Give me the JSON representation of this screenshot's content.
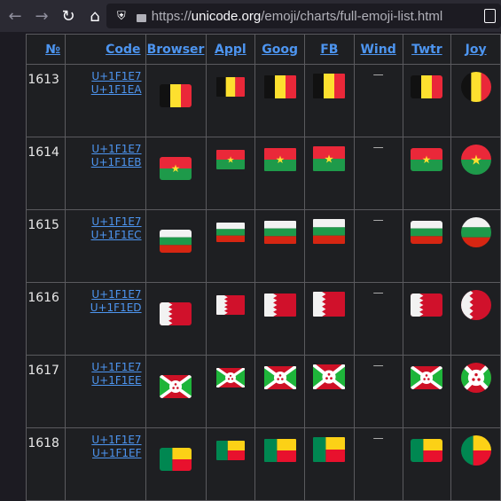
{
  "browser": {
    "back_icon": "arrow-left-icon",
    "forward_icon": "arrow-right-icon",
    "reload_icon": "reload-icon",
    "home_icon": "home-icon",
    "shield_icon": "tracking-protection-icon",
    "lock_icon": "lock-icon",
    "reader_icon": "reader-view-icon",
    "url_scheme": "https://",
    "url_host": "unicode.org",
    "url_path": "/emoji/charts/full-emoji-list.html"
  },
  "table": {
    "headers": [
      "№",
      "Code",
      "Browser",
      "Appl",
      "Goog",
      "FB",
      "Wind",
      "Twtr",
      "Joy"
    ],
    "missing_marker": "—",
    "rows": [
      {
        "num": "1613",
        "code1": "U+1F1E7",
        "code2": "U+1F1EA",
        "flag": "belgium",
        "colors": [
          "#1a1a1a",
          "#fde02f",
          "#ea2839"
        ]
      },
      {
        "num": "1614",
        "code1": "U+1F1E7",
        "code2": "U+1F1EB",
        "flag": "burkina-faso",
        "colors": [
          "#ea2839",
          "#1e9a4a",
          "#fde02f"
        ]
      },
      {
        "num": "1615",
        "code1": "U+1F1E7",
        "code2": "U+1F1EC",
        "flag": "bulgaria",
        "colors": [
          "#f2f2f2",
          "#1e9a4a",
          "#d62612"
        ]
      },
      {
        "num": "1616",
        "code1": "U+1F1E7",
        "code2": "U+1F1ED",
        "flag": "bahrain",
        "colors": [
          "#f2f2f2",
          "#d0112b"
        ]
      },
      {
        "num": "1617",
        "code1": "U+1F1E7",
        "code2": "U+1F1EE",
        "flag": "burundi",
        "colors": [
          "#ce1126",
          "#1eb53a",
          "#ffffff"
        ]
      },
      {
        "num": "1618",
        "code1": "U+1F1E7",
        "code2": "U+1F1EF",
        "flag": "benin",
        "colors": [
          "#008751",
          "#fcd116",
          "#e8112d"
        ]
      }
    ]
  }
}
